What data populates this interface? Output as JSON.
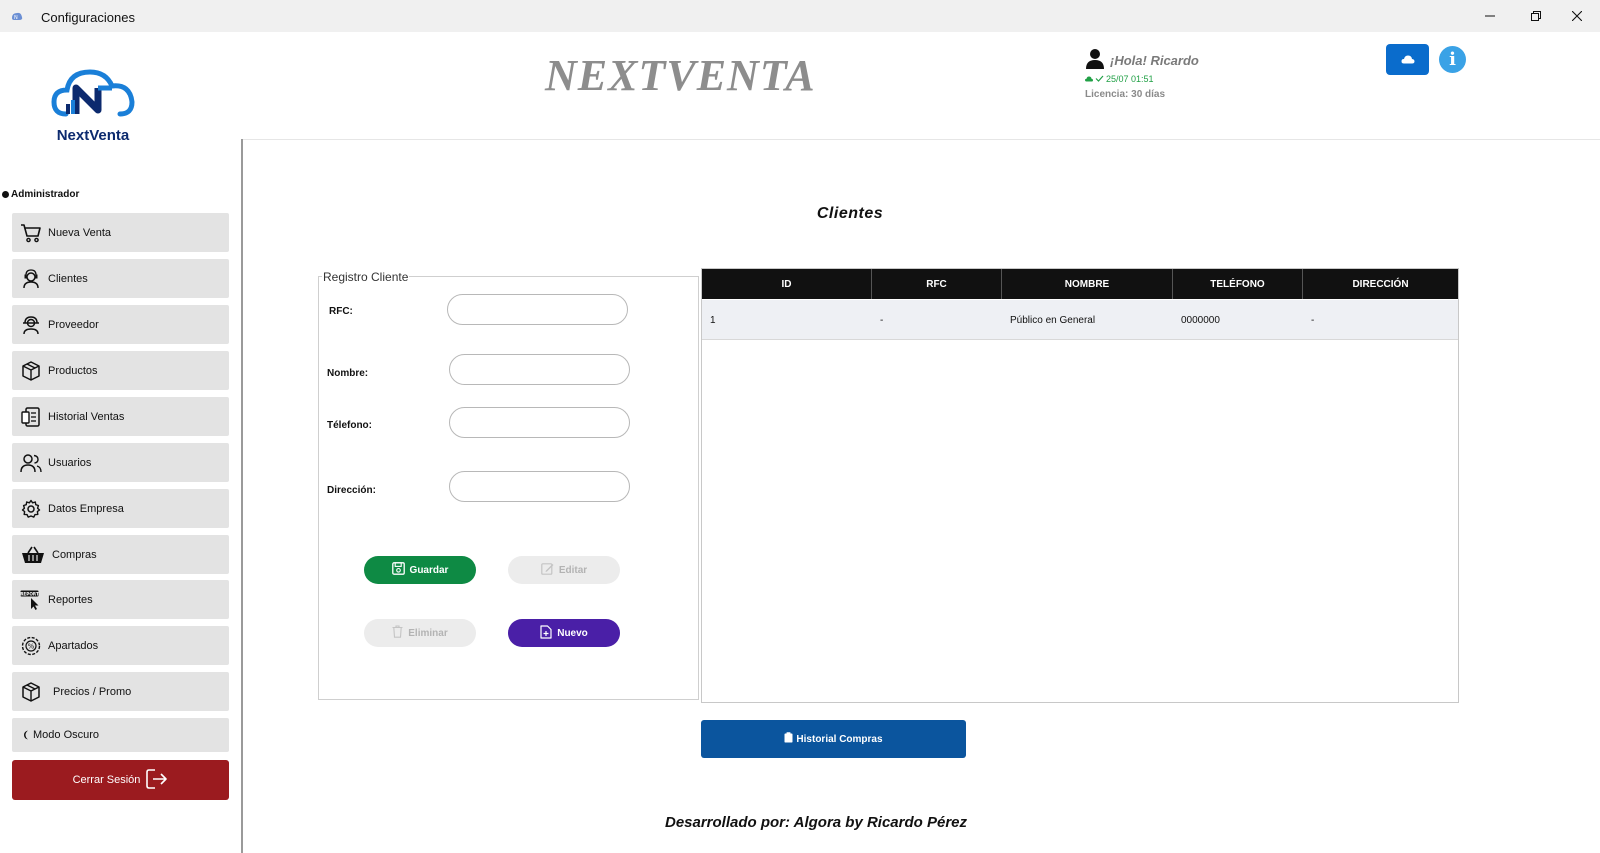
{
  "window": {
    "title": "Configuraciones",
    "icons": [
      "app-icon",
      "minimize-icon",
      "maximize-icon",
      "close-icon"
    ]
  },
  "header": {
    "brand_title": "NEXTVENTA",
    "logo_text": "NextVenta",
    "greeting": "¡Hola! Ricardo",
    "sync_time": "25/07 01:51",
    "license": "Licencia: 30 días",
    "info_label": "i"
  },
  "sidebar": {
    "role": "Administrador",
    "items": [
      {
        "label": "Nueva Venta",
        "icon": "cart-icon"
      },
      {
        "label": "Clientes",
        "icon": "client-icon"
      },
      {
        "label": "Proveedor",
        "icon": "supplier-icon"
      },
      {
        "label": "Productos",
        "icon": "box-icon"
      },
      {
        "label": "Historial Ventas",
        "icon": "sales-history-icon"
      },
      {
        "label": "Usuarios",
        "icon": "users-icon"
      },
      {
        "label": "Datos Empresa",
        "icon": "gear-icon"
      },
      {
        "label": "Compras",
        "icon": "basket-icon"
      },
      {
        "label": "Reportes",
        "icon": "report-icon"
      },
      {
        "label": "Apartados",
        "icon": "layaway-icon"
      },
      {
        "label": "Precios / Promo",
        "icon": "price-box-icon"
      }
    ],
    "dark_mode_label": "Modo Oscuro",
    "logout_label": "Cerrar Sesión"
  },
  "main": {
    "page_title": "Clientes",
    "form": {
      "legend": "Registro Cliente",
      "fields": [
        {
          "label": "RFC:",
          "value": ""
        },
        {
          "label": "Nombre:",
          "value": ""
        },
        {
          "label": "Télefono:",
          "value": ""
        },
        {
          "label": "Dirección:",
          "value": ""
        }
      ],
      "buttons": {
        "save": "Guardar",
        "edit": "Editar",
        "delete": "Eliminar",
        "new": "Nuevo"
      }
    },
    "table": {
      "columns": [
        "ID",
        "RFC",
        "NOMBRE",
        "TELÉFONO",
        "DIRECCIÓN"
      ],
      "rows": [
        [
          "1",
          "-",
          "Público en General",
          "0000000",
          "-"
        ]
      ]
    },
    "history_button": "Historial Compras",
    "footer": "Desarrollado por: Algora by Ricardo Pérez"
  },
  "colors": {
    "save": "#0e8a44",
    "new": "#4a1fa7",
    "logout": "#9b1b1f",
    "history": "#0b559e",
    "cloud_button": "#0a6ccc",
    "table_header": "#111111"
  }
}
